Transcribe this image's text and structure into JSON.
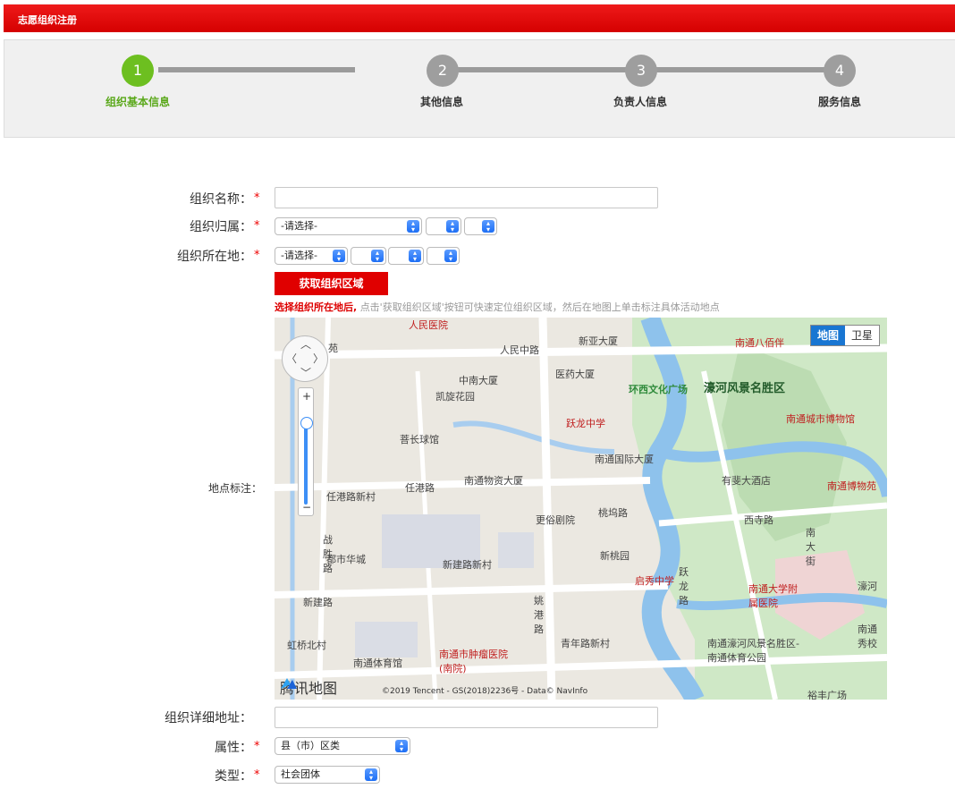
{
  "header": {
    "title": "志愿组织注册"
  },
  "steps": [
    {
      "num": "1",
      "label": "组织基本信息",
      "active": true
    },
    {
      "num": "2",
      "label": "其他信息",
      "active": false
    },
    {
      "num": "3",
      "label": "负责人信息",
      "active": false
    },
    {
      "num": "4",
      "label": "服务信息",
      "active": false
    }
  ],
  "form": {
    "org_name_label": "组织名称：",
    "org_affiliation_label": "组织归属：",
    "org_affiliation_select": "-请选择-",
    "org_location_label": "组织所在地：",
    "org_location_select": "-请选择-",
    "get_area_button": "获取组织区域",
    "hint_highlight": "选择组织所在地后,",
    "hint_text": "点击'获取组织区域'按钮可快速定位组织区域，然后在地图上单击标注具体活动地点",
    "map_label": "地点标注：",
    "address_label": "组织详细地址：",
    "attribute_label": "属性：",
    "attribute_value": "县（市）区类",
    "type_label": "类型：",
    "type_value": "社会团体",
    "required_mark": "*"
  },
  "map": {
    "type_map": "地图",
    "type_satellite": "卫星",
    "brand": "腾讯地图",
    "copyright": "©2019 Tencent - GS(2018)2236号 - Data© NavInfo",
    "zoom_in": "+",
    "zoom_out": "−",
    "pois": [
      "人民医院",
      "人民中路",
      "新亚大厦",
      "中南大厦",
      "医药大厦",
      "凯旋花园",
      "环西文化广场",
      "濠河风景名胜区",
      "南通八佰伴",
      "南通城市博物馆",
      "跃龙中学",
      "菩长球馆",
      "南通国际大厦",
      "有斐大酒店",
      "南通博物苑",
      "任港路新村",
      "任港路",
      "南通物资大厦",
      "更俗剧院",
      "桃坞路",
      "西寺路",
      "都市华城",
      "新建路新村",
      "新桃园",
      "启秀中学",
      "南通大学附属医院",
      "新建路",
      "姚港路",
      "虹桥北村",
      "青年路新村",
      "南通濠河风景名胜区-南通体育公园",
      "南通体育馆",
      "南通市肿瘤医院(南院)",
      "南通秀校",
      "裕丰广场",
      "战胜路",
      "跃龙路",
      "南大街",
      "苑",
      "濠河"
    ]
  }
}
